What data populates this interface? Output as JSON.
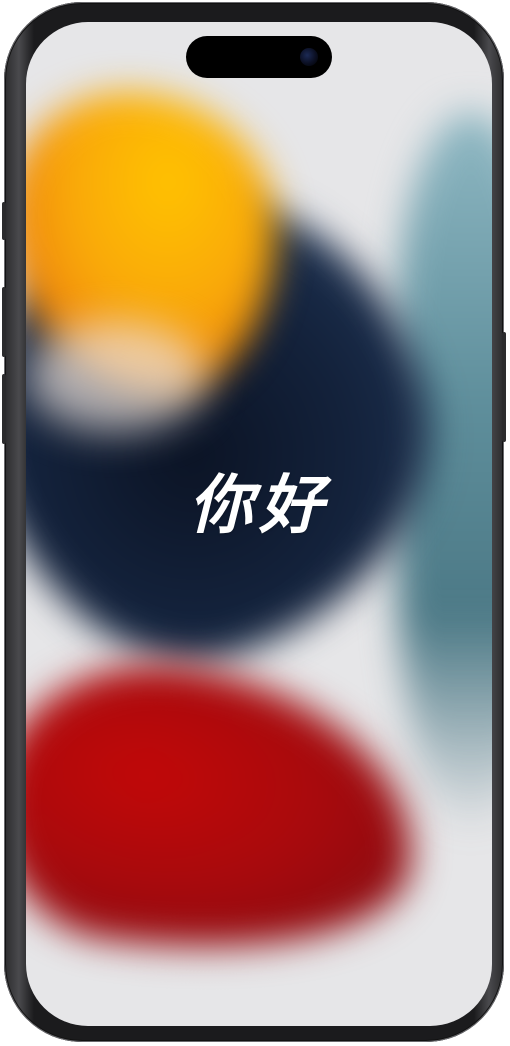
{
  "screen": {
    "greeting_text": "你好"
  },
  "wallpaper": {
    "colors": {
      "orange": "#f9a70a",
      "navy": "#14233d",
      "teal": "#5f8f9c",
      "red": "#a80a0d",
      "background": "#e6e6e8"
    }
  },
  "device": {
    "frame_color": "#1b1b1d"
  }
}
